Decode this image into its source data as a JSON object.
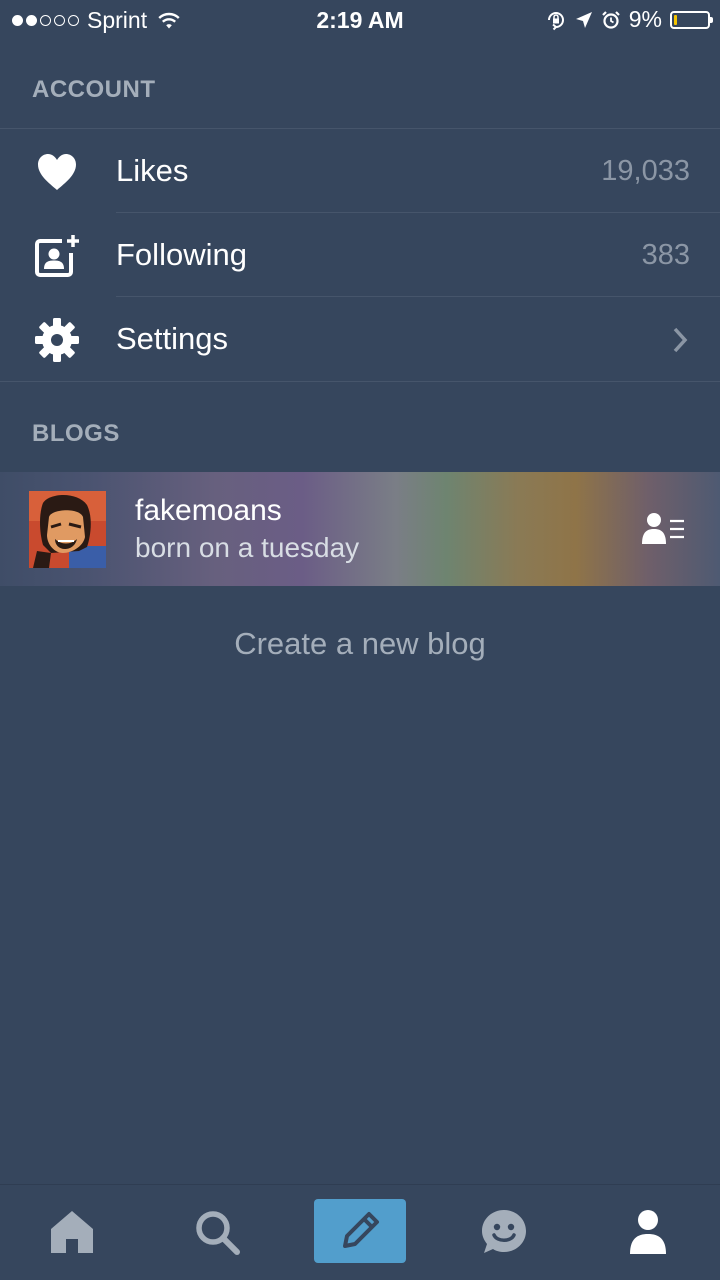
{
  "status_bar": {
    "signal_dots_filled": 2,
    "signal_dots_total": 5,
    "carrier": "Sprint",
    "time": "2:19 AM",
    "battery_percent": "9%",
    "battery_level": 0.09,
    "icons": [
      "wifi-icon",
      "rotation-lock-icon",
      "location-icon",
      "alarm-icon",
      "battery-icon"
    ]
  },
  "account": {
    "header": "ACCOUNT",
    "items": [
      {
        "label": "Likes",
        "value": "19,033",
        "icon": "heart-icon"
      },
      {
        "label": "Following",
        "value": "383",
        "icon": "following-icon"
      },
      {
        "label": "Settings",
        "icon": "gear-icon",
        "accessory": "chevron-right-icon"
      }
    ]
  },
  "blogs": {
    "header": "BLOGS",
    "items": [
      {
        "name": "fakemoans",
        "description": "born on a tuesday",
        "action_icon": "blog-switch-icon"
      }
    ],
    "create_label": "Create a new blog"
  },
  "tab_bar": {
    "tabs": [
      "home-icon",
      "search-icon",
      "compose-icon",
      "messaging-icon",
      "account-icon"
    ],
    "active": "account-icon",
    "compose_color": "#529ecc"
  },
  "colors": {
    "background": "#36465d",
    "header_text": "#a4aeba",
    "count_text": "#8b96a5",
    "divider": "#46556b"
  }
}
